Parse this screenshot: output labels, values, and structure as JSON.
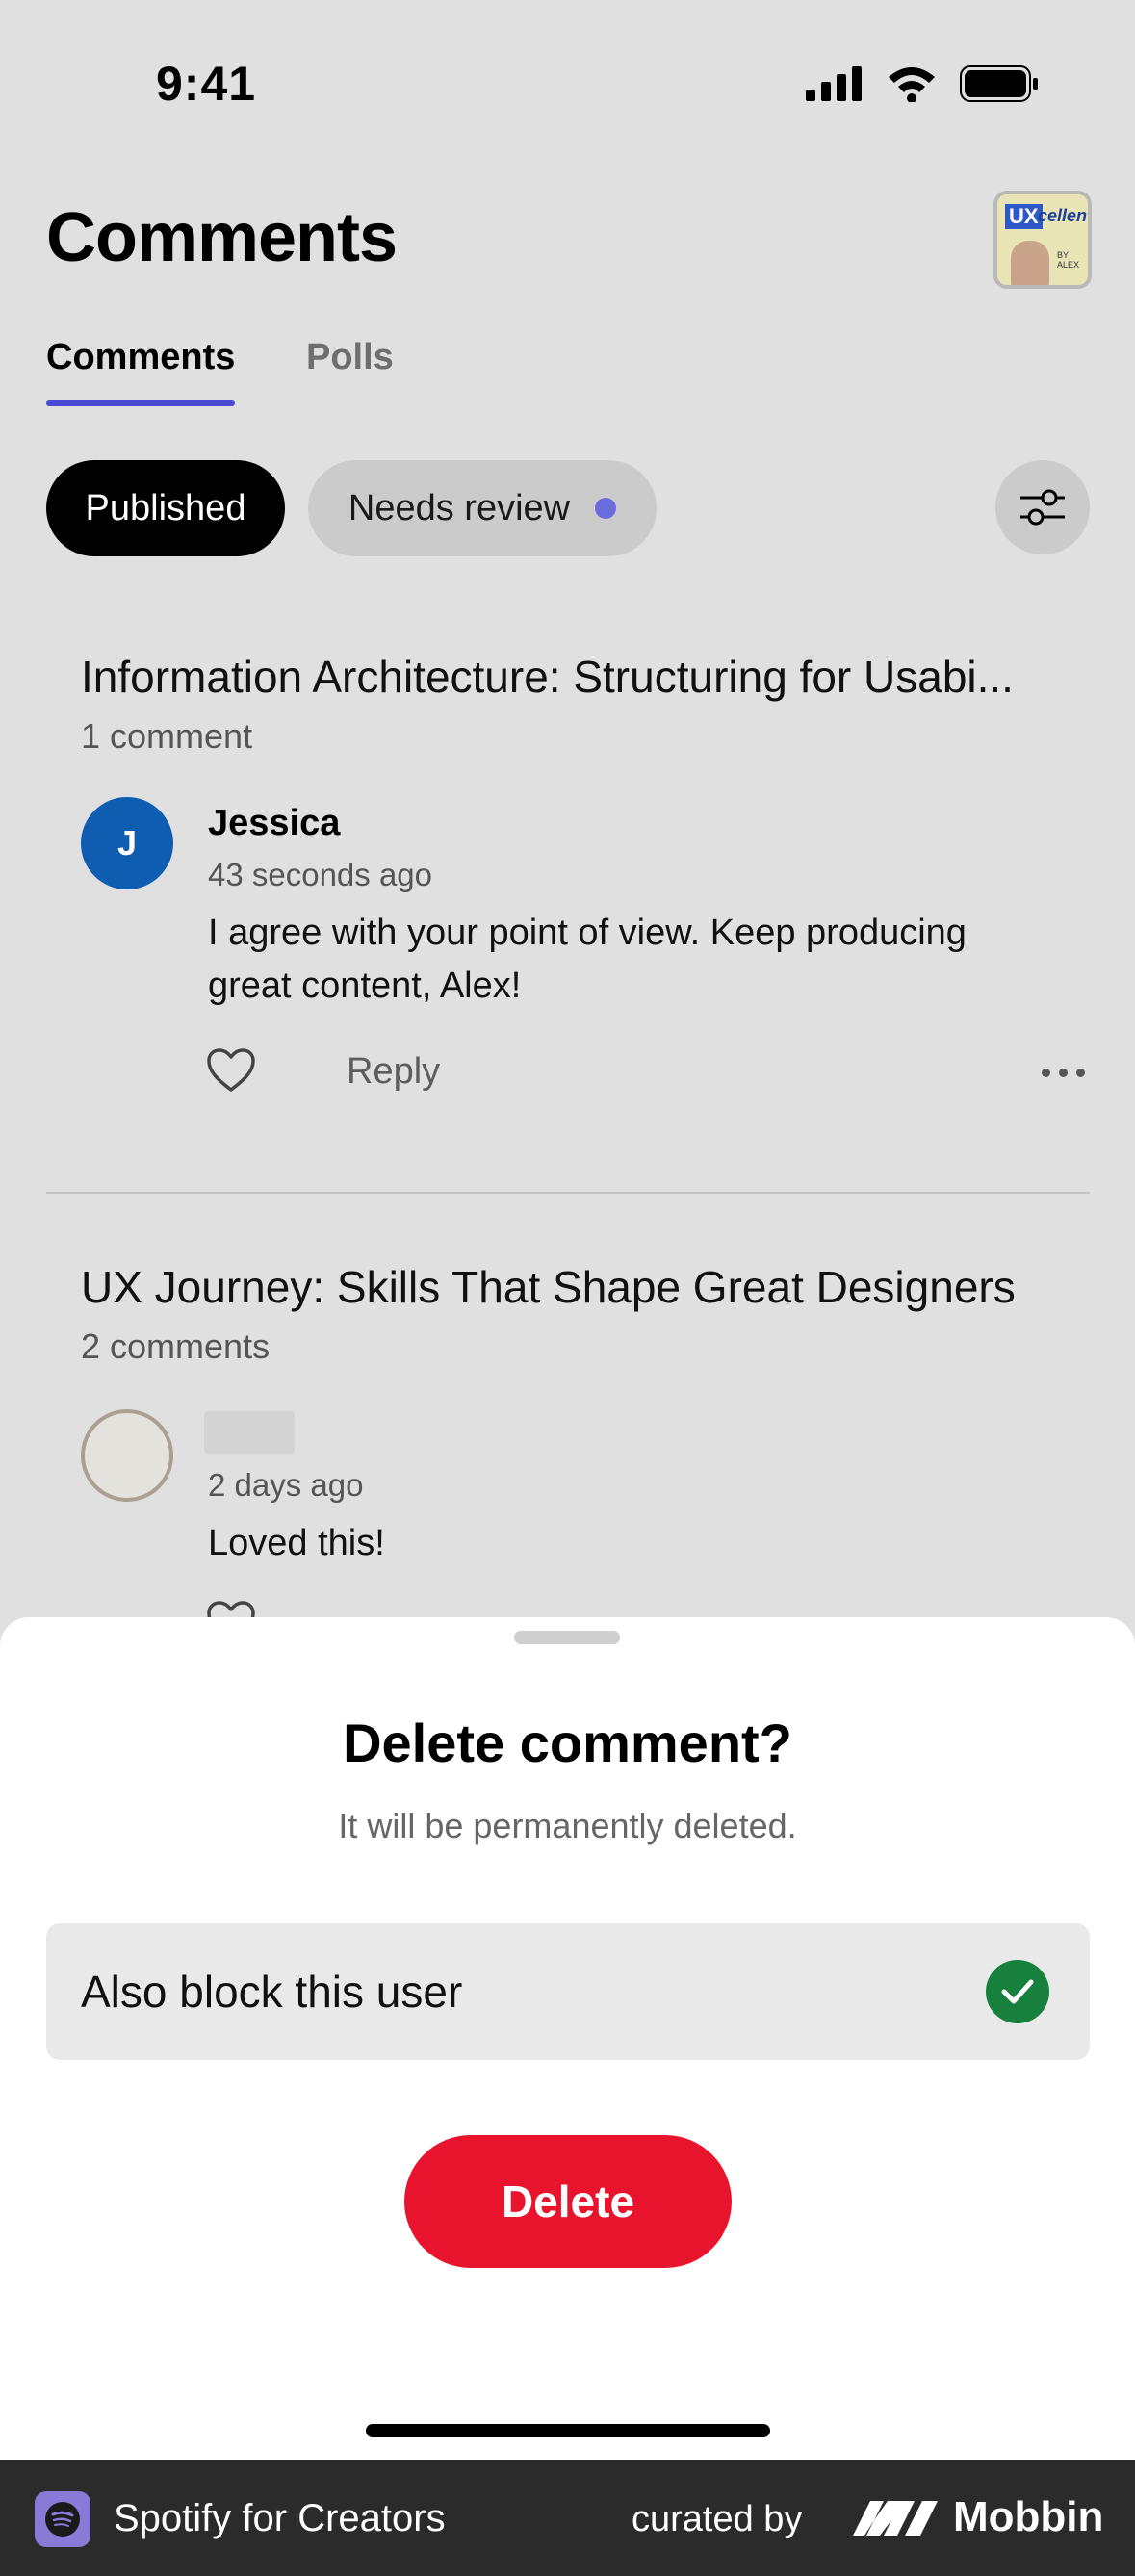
{
  "status_bar": {
    "time": "9:41"
  },
  "header": {
    "title": "Comments"
  },
  "tabs": [
    {
      "label": "Comments",
      "active": true
    },
    {
      "label": "Polls",
      "active": false
    }
  ],
  "filters": {
    "published": "Published",
    "needs_review": "Needs review"
  },
  "posts": [
    {
      "title": "Information Architecture: Structuring for Usabi...",
      "count": "1 comment",
      "comment": {
        "avatar_letter": "J",
        "author": "Jessica",
        "time": "43 seconds ago",
        "text": "I agree with your point of view. Keep producing great content, Alex!",
        "reply_label": "Reply"
      }
    },
    {
      "title": "UX Journey: Skills That Shape Great Designers",
      "count": "2 comments",
      "comment": {
        "time": "2 days ago",
        "text": "Loved this!"
      }
    }
  ],
  "sheet": {
    "title": "Delete comment?",
    "subtitle": "It will be permanently deleted.",
    "block_label": "Also block this user",
    "block_checked": true,
    "delete_label": "Delete"
  },
  "footer": {
    "app_name": "Spotify for Creators",
    "curated_by": "curated by",
    "brand": "Mobbin"
  },
  "colors": {
    "accent": "#4a4ad2",
    "delete": "#e8132c",
    "check": "#17803d",
    "avatar": "#0e5db0"
  }
}
